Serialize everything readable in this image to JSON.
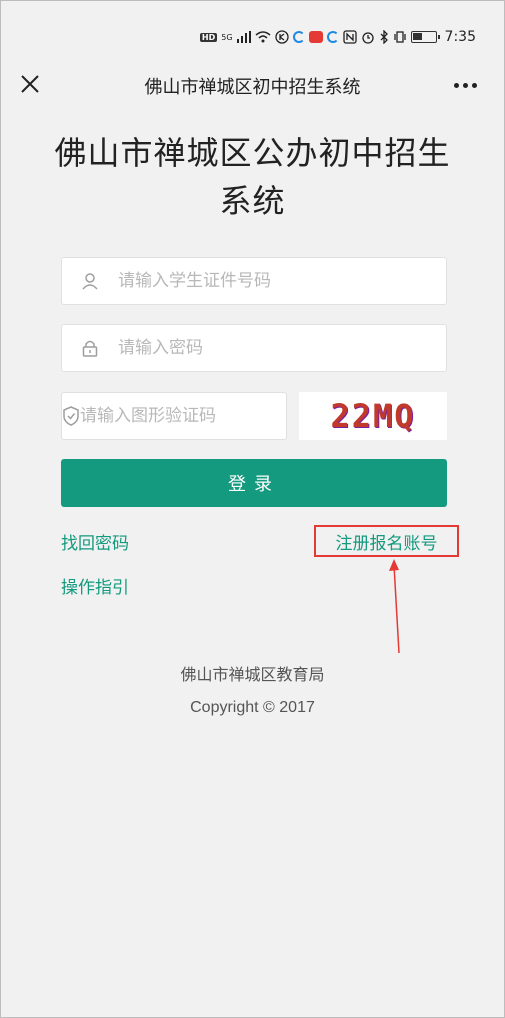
{
  "status_bar": {
    "hd_label": "HD",
    "network_label": "5G",
    "time": "7:35"
  },
  "header": {
    "title": "佛山市禅城区初中招生系统"
  },
  "main": {
    "system_title": "佛山市禅城区公办初中招生系统",
    "student_id": {
      "value": "",
      "placeholder": "请输入学生证件号码"
    },
    "password": {
      "value": "",
      "placeholder": "请输入密码"
    },
    "captcha_input": {
      "value": "",
      "placeholder": "请输入图形验证码"
    },
    "captcha_text": "22MQ",
    "login_label": "登录",
    "forgot_password": "找回密码",
    "register_account": "注册报名账号",
    "guide": "操作指引"
  },
  "footer": {
    "org": "佛山市禅城区教育局",
    "copyright": "Copyright © 2017"
  },
  "colors": {
    "accent": "#149a7e",
    "annotation": "#e53935"
  }
}
